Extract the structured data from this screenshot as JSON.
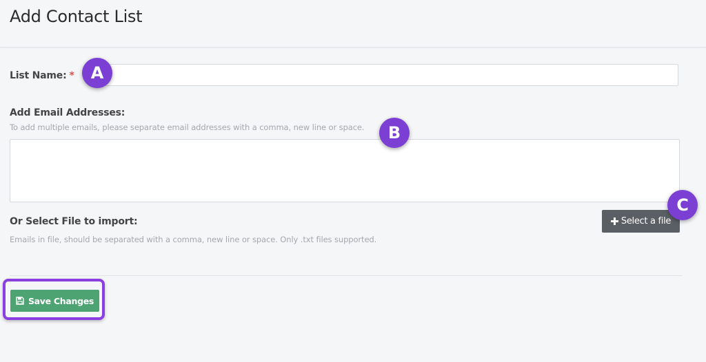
{
  "header": {
    "title": "Add Contact List"
  },
  "form": {
    "list_name_label": "List Name:",
    "required_mark": "*",
    "list_name_value": "",
    "emails_label": "Add Email Addresses:",
    "emails_hint": "To add multiple emails, please separate email addresses with a comma, new line or space.",
    "emails_value": "",
    "file_label": "Or Select File to import:",
    "file_hint": "Emails in file, should be separated with a comma, new line or space. Only .txt files supported.",
    "select_file_label": "Select a file",
    "save_label": "Save Changes"
  },
  "annotations": {
    "marker_a": "A",
    "marker_b": "B",
    "marker_c": "C",
    "marker_color": "#7c3fd4",
    "highlight_color": "#8b3fe0"
  },
  "colors": {
    "save_button": "#4ea373",
    "file_button": "#5a5f66",
    "required": "#d9534f"
  },
  "icons": {
    "file_button_icon": "plus-icon",
    "save_button_icon": "floppy-disk-icon"
  }
}
